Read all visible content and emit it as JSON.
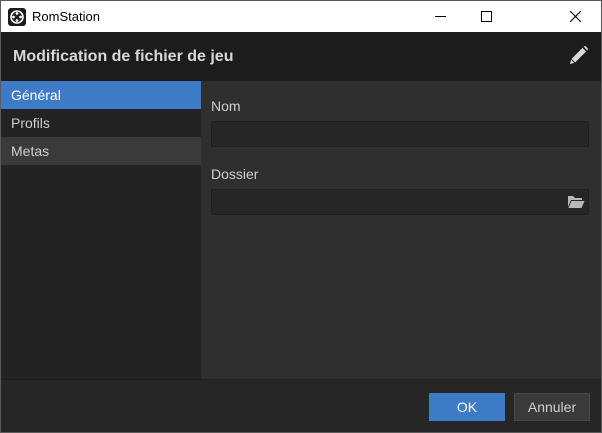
{
  "window": {
    "app_title": "RomStation",
    "minimize_icon": "minimize-icon",
    "maximize_icon": "maximize-icon",
    "close_icon": "close-icon"
  },
  "header": {
    "title": "Modification de fichier de jeu",
    "edit_icon": "pencil-icon"
  },
  "sidebar": {
    "items": [
      {
        "label": "Général",
        "state": "selected"
      },
      {
        "label": "Profils",
        "state": "normal"
      },
      {
        "label": "Metas",
        "state": "hover"
      }
    ]
  },
  "form": {
    "name_label": "Nom",
    "name_value": "",
    "folder_label": "Dossier",
    "folder_value": "",
    "folder_icon": "folder-open-icon"
  },
  "footer": {
    "ok_label": "OK",
    "cancel_label": "Annuler"
  },
  "colors": {
    "accent": "#3d7bc7",
    "header_bg": "#1c1c1c",
    "sidebar_bg": "#232323",
    "panel_bg": "#2f2f2f"
  }
}
